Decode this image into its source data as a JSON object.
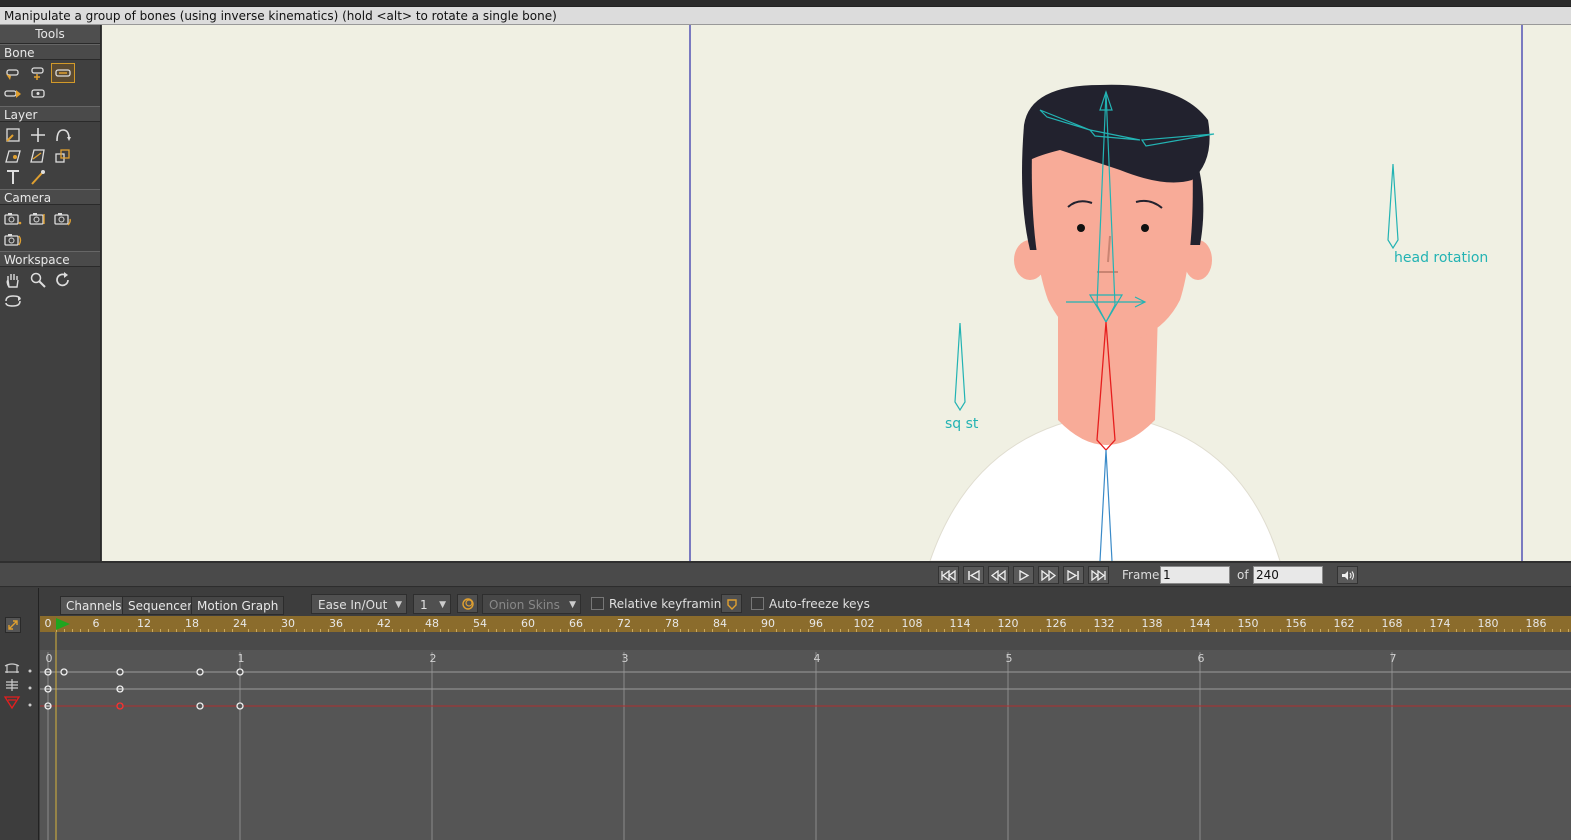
{
  "status_message": "Manipulate a group of bones (using inverse kinematics) (hold <alt> to rotate a single bone)",
  "toolbox": {
    "title": "Tools",
    "sections": [
      {
        "label": "Bone",
        "tools": [
          "select-bone-icon",
          "translate-bone-icon",
          "manipulate-bones-icon",
          "add-bone-icon",
          "bone-strength-icon"
        ]
      },
      {
        "label": "Layer",
        "tools": [
          "set-origin-icon",
          "transform-layer-icon",
          "rotate-layer-icon",
          "shear-layer-icon",
          "perspective-icon",
          "bind-layer-icon",
          "text-icon",
          "eyedropper-icon"
        ]
      },
      {
        "label": "Camera",
        "tools": [
          "track-camera-icon",
          "zoom-camera-icon",
          "roll-camera-icon",
          "pan-tilt-camera-icon"
        ]
      },
      {
        "label": "Workspace",
        "tools": [
          "hand-icon",
          "zoom-icon",
          "rotate-workspace-icon",
          "orbit-icon"
        ]
      }
    ],
    "active_tool": "manipulate-bones-icon"
  },
  "canvas": {
    "labels": {
      "head_rotation": "head rotation",
      "squash_stretch": "sq st"
    },
    "colors": {
      "background": "#f0f0e3",
      "bone": "#23b3b3",
      "selected_bone": "#e61e1e",
      "skin": "#f8ab98",
      "hair": "#22222e",
      "shirt": "#ffffff",
      "frame_line": "#7a7ac0"
    }
  },
  "playback": {
    "buttons": [
      "rewind-icon",
      "step-back-icon",
      "previous-keyframe-icon",
      "play-icon",
      "next-keyframe-icon",
      "step-forward-icon",
      "fast-forward-icon"
    ],
    "frame_label": "Frame",
    "frame_value": "1",
    "of_label": "of",
    "end_frame": "240",
    "volume_icon": "volume-icon"
  },
  "timeline": {
    "tabs": [
      "Channels",
      "Sequencer",
      "Motion Graph"
    ],
    "active_tab": "Channels",
    "interpolation": "Ease In/Out",
    "interp_param": "1",
    "onion_skins": "Onion Skins",
    "relative_keyframing": "Relative keyframing",
    "relative_checked": false,
    "auto_freeze": "Auto-freeze keys",
    "auto_freeze_checked": false,
    "ruler_ticks": [
      "0",
      "6",
      "12",
      "18",
      "24",
      "30",
      "36",
      "42",
      "48",
      "54",
      "60",
      "66",
      "72",
      "78",
      "84",
      "90",
      "96",
      "102",
      "108",
      "114",
      "120",
      "126",
      "132",
      "138",
      "144",
      "150",
      "156",
      "162",
      "168",
      "174",
      "180",
      "186"
    ],
    "current_frame": 1,
    "second_markers": [
      "0",
      "1",
      "2",
      "3",
      "4",
      "5",
      "6",
      "7"
    ],
    "channels": [
      {
        "name": "bone-rotation-channel",
        "keys": [
          0,
          2,
          9,
          19,
          24
        ]
      },
      {
        "name": "bone-translation-channel",
        "keys": [
          0,
          9
        ]
      },
      {
        "name": "bone-scale-channel",
        "keys": [
          0,
          9,
          19,
          24
        ],
        "selected_key": 9
      }
    ]
  }
}
